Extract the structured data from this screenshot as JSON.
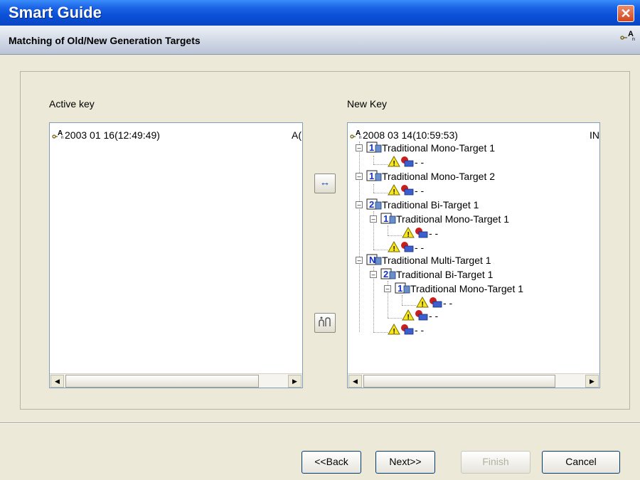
{
  "window": {
    "title": "Smart Guide",
    "close_symbol": "✕"
  },
  "header": {
    "title": "Matching of Old/New Generation Targets",
    "key_icon": "key-icon"
  },
  "active_panel": {
    "label": "Active key",
    "root": {
      "text": "2003 01 16(12:49:49)",
      "status": "A("
    }
  },
  "new_panel": {
    "label": "New Key",
    "root": {
      "text": "2008 03 14(10:59:53)",
      "status": "IN"
    },
    "items": [
      {
        "badge": "1",
        "label": "Traditional Mono-Target 1"
      },
      {
        "dashes": "- -"
      },
      {
        "badge": "1",
        "label": "Traditional Mono-Target 2"
      },
      {
        "dashes": "- -"
      },
      {
        "badge": "2",
        "label": "Traditional Bi-Target 1"
      },
      {
        "badge": "1",
        "label": "Traditional Mono-Target 1"
      },
      {
        "dashes": "- -"
      },
      {
        "dashes": "- -"
      },
      {
        "badge": "N",
        "label": "Traditional Multi-Target 1"
      },
      {
        "badge": "2",
        "label": "Traditional Bi-Target 1"
      },
      {
        "badge": "1",
        "label": "Traditional Mono-Target 1"
      },
      {
        "dashes": "- -"
      },
      {
        "dashes": "- -"
      },
      {
        "dashes": "- -"
      }
    ]
  },
  "middle_buttons": {
    "match_symbol": "↔",
    "auto_symbol": "⁂"
  },
  "footer": {
    "back": "<<Back",
    "next": "Next>>",
    "finish": "Finish",
    "cancel": "Cancel"
  }
}
